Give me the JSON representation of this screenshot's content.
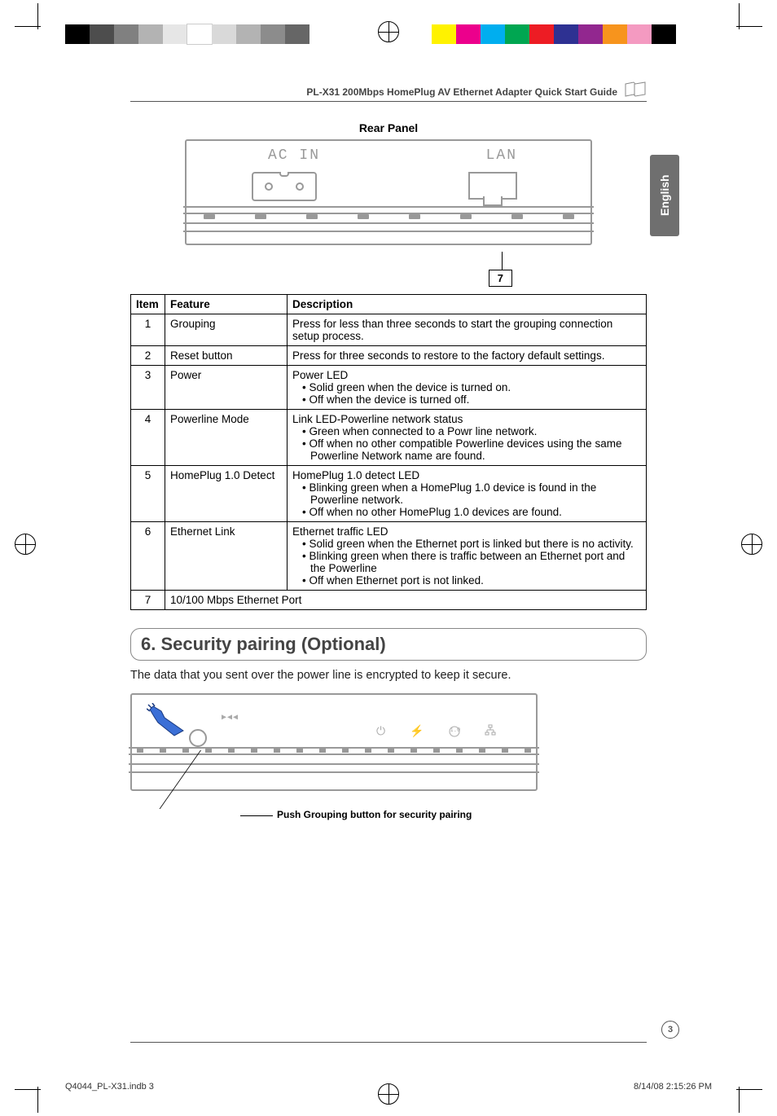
{
  "running_head": "PL-X31 200Mbps HomePlug AV Ethernet Adapter Quick Start Guide",
  "language_tab": "English",
  "rear_panel": {
    "caption": "Rear Panel",
    "ac_label": "AC IN",
    "lan_label": "LAN",
    "callout_number": "7"
  },
  "table": {
    "headers": {
      "item": "Item",
      "feature": "Feature",
      "description": "Description"
    },
    "rows": [
      {
        "item": "1",
        "feature": "Grouping",
        "description": {
          "lead": "Press for less than three seconds to start the grouping connection setup process.",
          "bullets": []
        }
      },
      {
        "item": "2",
        "feature": "Reset button",
        "description": {
          "lead": "Press for three seconds to restore to the factory default settings.",
          "bullets": []
        }
      },
      {
        "item": "3",
        "feature": "Power",
        "description": {
          "lead": "Power LED",
          "bullets": [
            "Solid green when the device is turned on.",
            "Off when the device is turned off."
          ]
        }
      },
      {
        "item": "4",
        "feature": "Powerline Mode",
        "description": {
          "lead": "Link LED-Powerline network status",
          "bullets": [
            "Green when connected to a Powr line network.",
            "Off when no other compatible Powerline devices using the same Powerline Network name are found."
          ]
        }
      },
      {
        "item": "5",
        "feature": "HomePlug 1.0 Detect",
        "description": {
          "lead": "HomePlug 1.0 detect LED",
          "bullets": [
            "Blinking green when a HomePlug 1.0 device is found in the Powerline network.",
            "Off when no other HomePlug 1.0 devices are found."
          ]
        }
      },
      {
        "item": "6",
        "feature": "Ethernet Link",
        "description": {
          "lead": "Ethernet traffic LED",
          "bullets": [
            "Solid green when the Ethernet port is linked but there is no activity.",
            "Blinking green when there is traffic between an Ethernet port and the Powerline",
            "Off when Ethernet port is not linked."
          ]
        }
      },
      {
        "item": "7",
        "feature_colspan": "10/100 Mbps Ethernet Port"
      }
    ]
  },
  "section6": {
    "heading": "6. Security pairing (Optional)",
    "body": "The data that you sent over the power line is encrypted to keep it secure.",
    "reset_label": "▶◀◀",
    "icons": {
      "power": "⏻",
      "link": "⚡",
      "homeplug": "1.0",
      "lan": "⎓"
    },
    "callout": "Push Grouping button for security pairing"
  },
  "page_number": "3",
  "imposition": {
    "file": "Q4044_PL-X31.indb   3",
    "timestamp": "8/14/08   2:15:26 PM"
  },
  "registration_colors_left": [
    "#000",
    "#4d4d4d",
    "#808080",
    "#b3b3b3",
    "#e6e6e6",
    "#fff",
    "#d9d9d9",
    "#b3b3b3",
    "#8c8c8c",
    "#666"
  ],
  "registration_colors_right": [
    "#fff200",
    "#ec008c",
    "#00aeef",
    "#00a651",
    "#ed1c24",
    "#2e3192",
    "#92278f",
    "#f7941d",
    "#f49ac1",
    "#000"
  ]
}
